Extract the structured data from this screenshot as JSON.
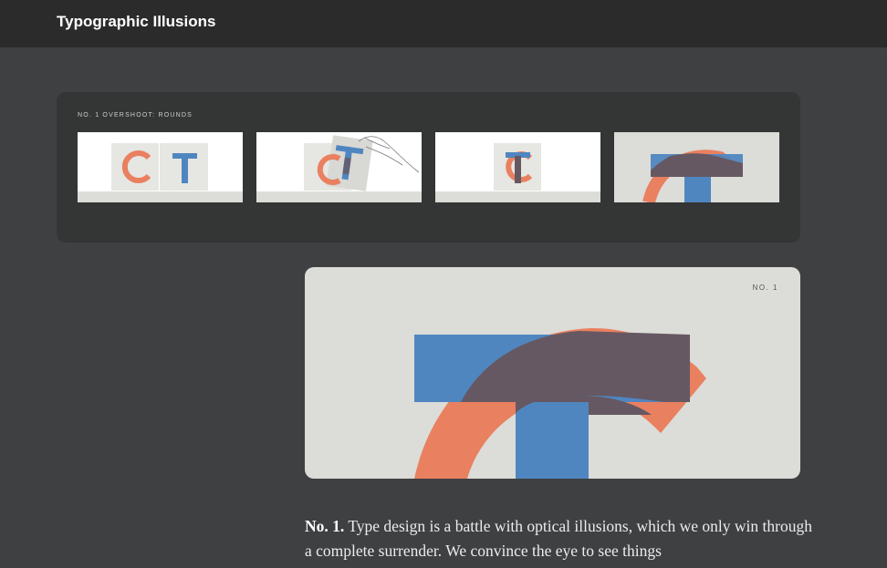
{
  "header": {
    "title": "Typographic Illusions"
  },
  "strip": {
    "label": "NO. 1  OVERSHOOT: ROUNDS",
    "thumbs": [
      {
        "letters": "C T"
      },
      {
        "letters": "C T"
      },
      {
        "letters": "C T"
      },
      {
        "letters": "T"
      }
    ]
  },
  "hero": {
    "tag": "NO. 1"
  },
  "article": {
    "lead": "No. 1.",
    "text": " Type design is a battle with optical illusions, which we only win through a complete surrender. We convince the eye to see things"
  },
  "colors": {
    "orange": "#e9805f",
    "blue": "#4f86c0",
    "overlap": "#665862"
  }
}
